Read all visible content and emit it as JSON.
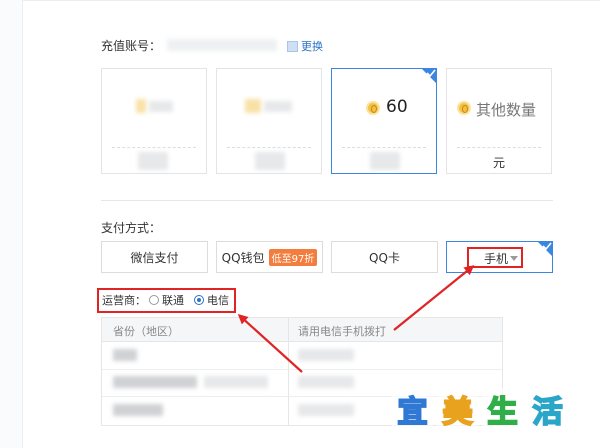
{
  "account": {
    "label": "充值账号：",
    "change_link": "更换"
  },
  "amount_cards": [
    {
      "amount": "",
      "unit": "",
      "selected": false
    },
    {
      "amount": "",
      "unit": "",
      "selected": false
    },
    {
      "amount": "60",
      "unit": "",
      "selected": true
    },
    {
      "amount": "其他数量",
      "unit": "元",
      "selected": false
    }
  ],
  "payment": {
    "label": "支付方式：",
    "methods": [
      {
        "label": "微信支付",
        "badge": ""
      },
      {
        "label": "QQ钱包",
        "badge": "低至97折"
      },
      {
        "label": "QQ卡",
        "badge": ""
      },
      {
        "label": "手机",
        "badge": ""
      }
    ],
    "selected": "手机"
  },
  "carrier": {
    "label": "运营商：",
    "options": [
      "联通",
      "电信"
    ],
    "selected": "电信"
  },
  "table": {
    "headers": [
      "省份（地区）",
      "请用电信手机拨打"
    ]
  },
  "watermark": {
    "chars": [
      "宜",
      "美",
      "生",
      "活"
    ]
  },
  "colors": {
    "accent": "#3d86e0",
    "link": "#2b73c9",
    "annotation": "#e02424",
    "promo": "#f47c3c",
    "coin": "#f3c044",
    "watermark": [
      "#2f79d4",
      "#e8a21e",
      "#2fae4a",
      "#2aa6c9"
    ]
  }
}
